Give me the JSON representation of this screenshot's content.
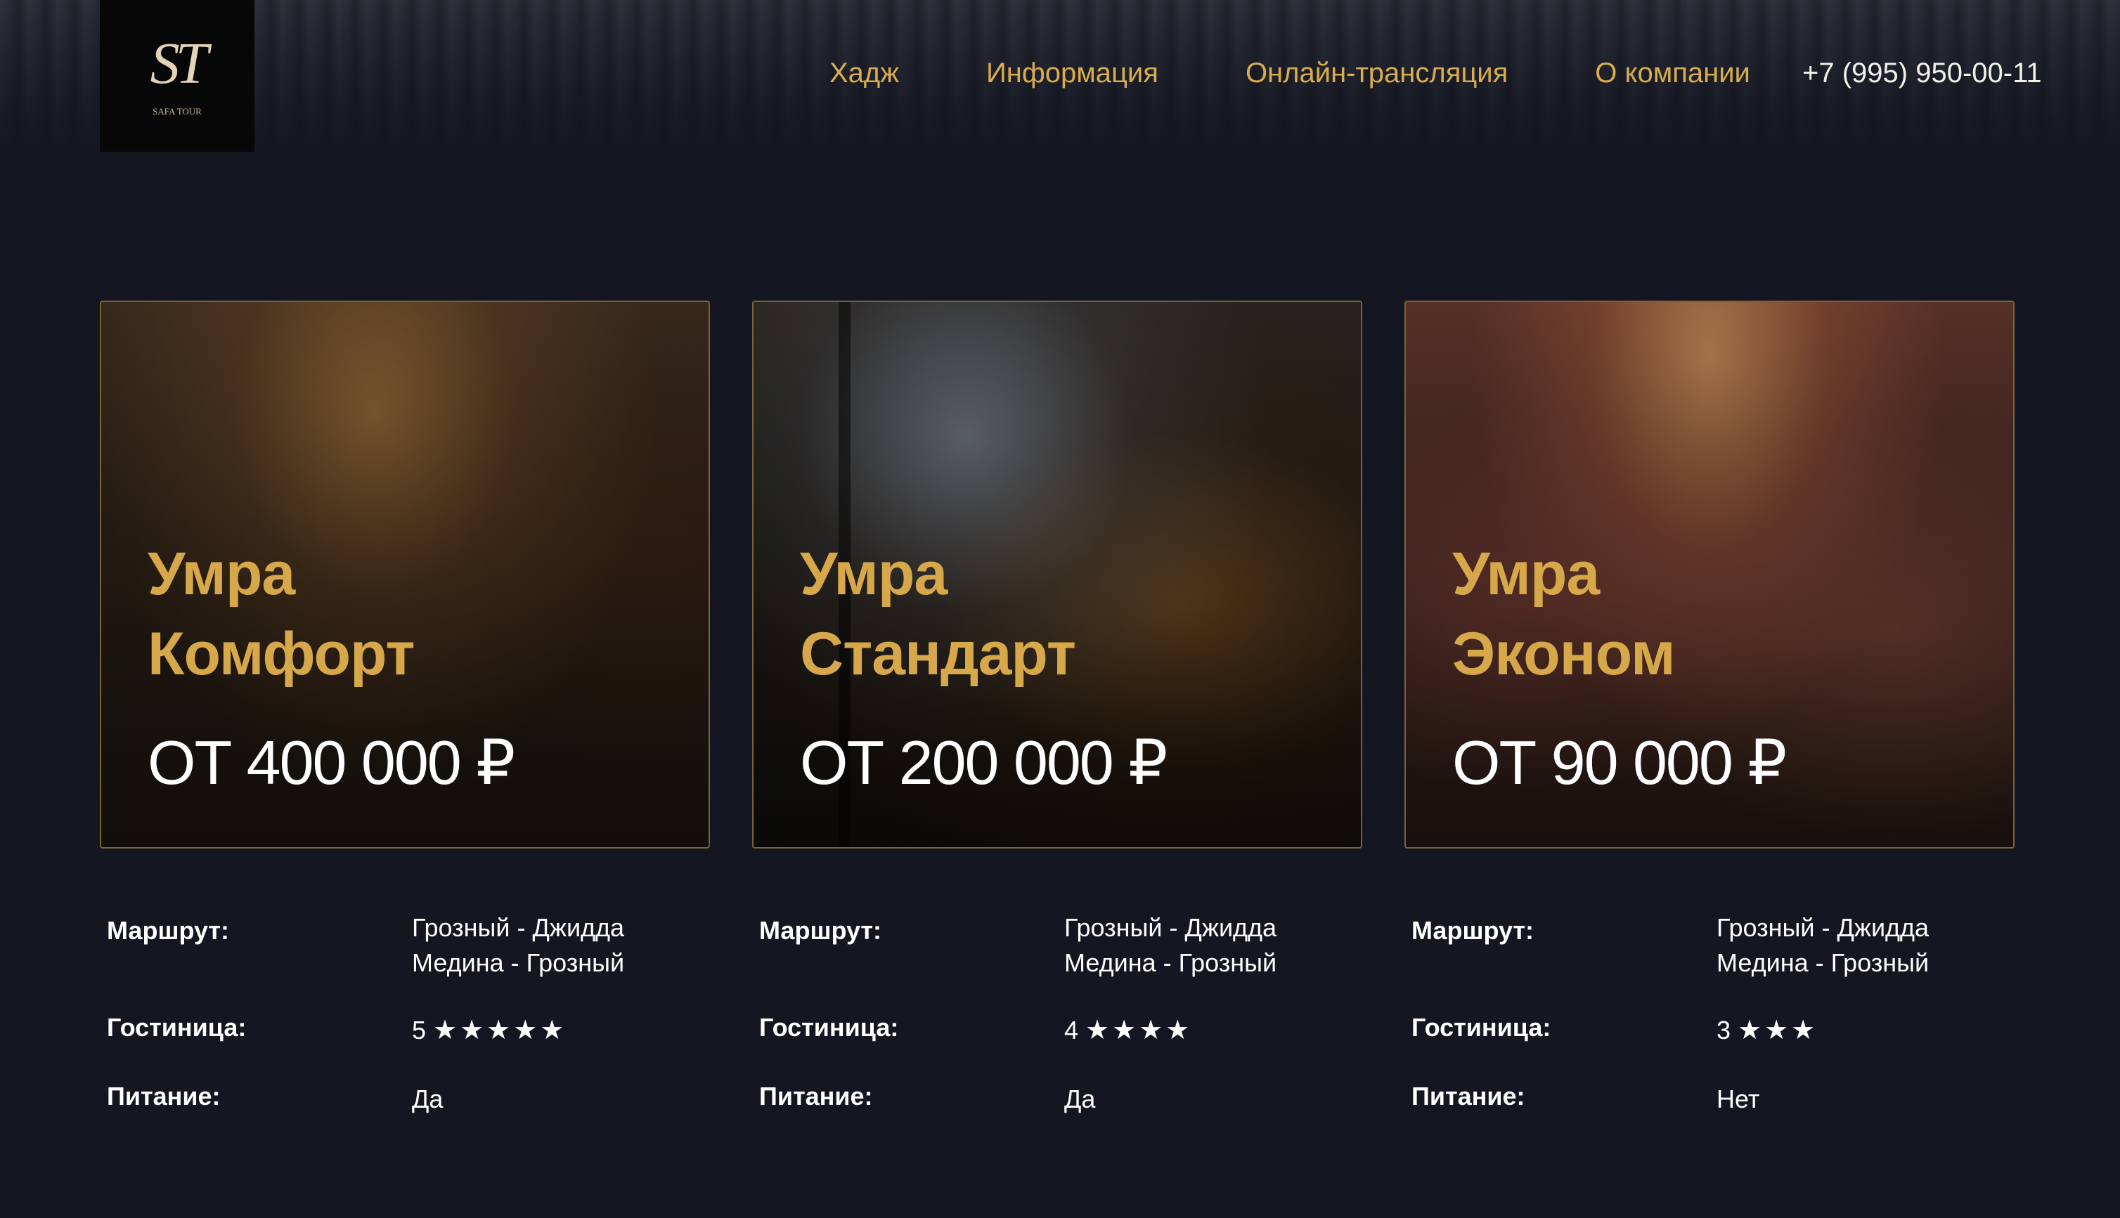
{
  "header": {
    "logo_mark": "ST",
    "logo_text": "SAFA TOUR",
    "nav": [
      "Хадж",
      "Информация",
      "Онлайн-трансляция",
      "О компании"
    ],
    "phone": "+7 (995) 950-00-11"
  },
  "cards": [
    {
      "title_line1": "Умра",
      "title_line2": "Комфорт",
      "price": "ОТ 400 000 ₽",
      "route_label": "Маршрут:",
      "route_line1": "Грозный - Джидда",
      "route_line2": "Медина - Грозный",
      "hotel_label": "Гостиница:",
      "hotel_value": "5",
      "hotel_stars": "★★★★★",
      "meal_label": "Питание:",
      "meal_value": "Да"
    },
    {
      "title_line1": "Умра",
      "title_line2": "Стандарт",
      "price": "ОТ 200 000 ₽",
      "route_label": "Маршрут:",
      "route_line1": "Грозный - Джидда",
      "route_line2": "Медина - Грозный",
      "hotel_label": "Гостиница:",
      "hotel_value": "4",
      "hotel_stars": "★★★★",
      "meal_label": "Питание:",
      "meal_value": "Да"
    },
    {
      "title_line1": "Умра",
      "title_line2": "Эконом",
      "price": "ОТ 90 000 ₽",
      "route_label": "Маршрут:",
      "route_line1": "Грозный - Джидда",
      "route_line2": "Медина - Грозный",
      "hotel_label": "Гостиница:",
      "hotel_value": "3",
      "hotel_stars": "★★★",
      "meal_label": "Питание:",
      "meal_value": "Нет"
    }
  ],
  "colors": {
    "background": "#141722",
    "accent_gold": "#d6a84a",
    "nav_gold": "#d9ad4e",
    "card_border": "#7a6433",
    "text": "#ffffff"
  }
}
